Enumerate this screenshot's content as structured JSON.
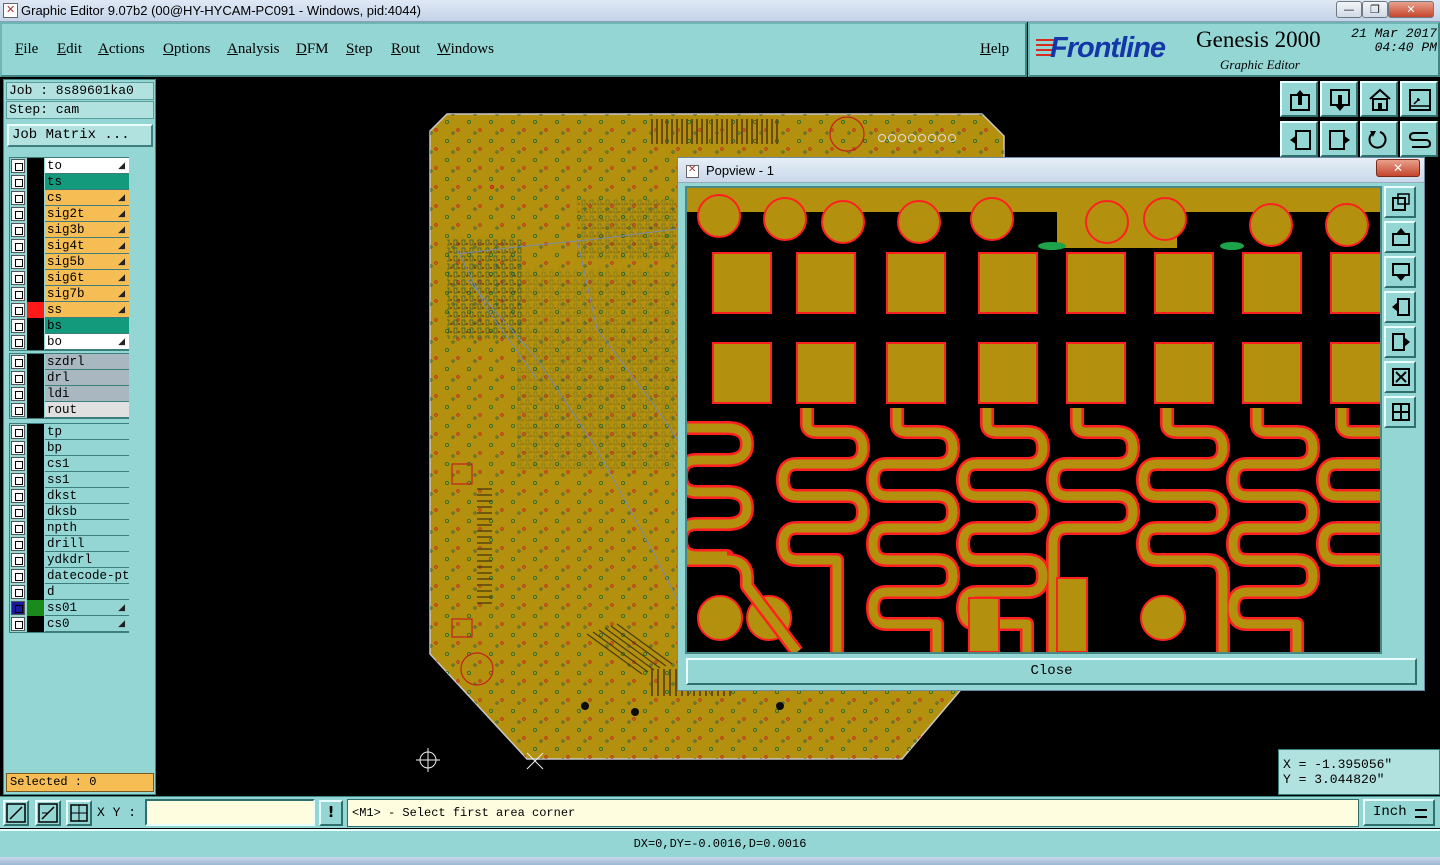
{
  "window": {
    "title": "Graphic Editor 9.07b2 (00@HY-HYCAM-PC091 - Windows, pid:4044)"
  },
  "menu": {
    "items": [
      "File",
      "Edit",
      "Actions",
      "Options",
      "Analysis",
      "DFM",
      "Step",
      "Rout",
      "Windows"
    ],
    "help": "Help"
  },
  "brand": {
    "logo": "Frontline",
    "product": "Genesis 2000",
    "subtitle": "Graphic Editor",
    "date": "21 Mar 2017",
    "time": "04:40 PM"
  },
  "job": {
    "job_label": "Job : 8s89601ka0",
    "step_label": "Step: cam",
    "matrix_button": "Job Matrix ..."
  },
  "layers": {
    "board": [
      {
        "name": "to",
        "color": "#ffffff",
        "lock": true
      },
      {
        "name": "ts",
        "color": "#139a7d",
        "lock": false
      },
      {
        "name": "cs",
        "color": "#f5bd54",
        "lock": true
      },
      {
        "name": "sig2t",
        "color": "#f5bd54",
        "lock": true
      },
      {
        "name": "sig3b",
        "color": "#f5bd54",
        "lock": true
      },
      {
        "name": "sig4t",
        "color": "#f5bd54",
        "lock": true
      },
      {
        "name": "sig5b",
        "color": "#f5bd54",
        "lock": true
      },
      {
        "name": "sig6t",
        "color": "#f5bd54",
        "lock": true
      },
      {
        "name": "sig7b",
        "color": "#f5bd54",
        "lock": true
      },
      {
        "name": "ss",
        "color": "#f5bd54",
        "lock": true,
        "marker": "#ff1a1a"
      },
      {
        "name": "bs",
        "color": "#139a7d",
        "lock": false
      },
      {
        "name": "bo",
        "color": "#ffffff",
        "lock": true
      }
    ],
    "drill": [
      {
        "name": "szdrl",
        "color": "#a9b7c0"
      },
      {
        "name": "drl",
        "color": "#a9b7c0"
      },
      {
        "name": "ldi",
        "color": "#a9b7c0"
      },
      {
        "name": "rout",
        "color": "#e0e0e0"
      }
    ],
    "misc": [
      {
        "name": "tp",
        "color": "#94d6d4"
      },
      {
        "name": "bp",
        "color": "#94d6d4"
      },
      {
        "name": "cs1",
        "color": "#94d6d4"
      },
      {
        "name": "ss1",
        "color": "#94d6d4"
      },
      {
        "name": "dkst",
        "color": "#94d6d4"
      },
      {
        "name": "dksb",
        "color": "#94d6d4"
      },
      {
        "name": "npth",
        "color": "#94d6d4"
      },
      {
        "name": "drill",
        "color": "#94d6d4"
      },
      {
        "name": "ydkdrl",
        "color": "#94d6d4"
      },
      {
        "name": "datecode-ptc",
        "color": "#94d6d4"
      },
      {
        "name": "d",
        "color": "#94d6d4"
      },
      {
        "name": "ss01",
        "color": "#94d6d4",
        "lock": true,
        "marker": "#1a8a1a",
        "checkbox": "#1a1a9a"
      },
      {
        "name": "cs0",
        "color": "#94d6d4",
        "lock": true
      }
    ]
  },
  "selected": "Selected : 0",
  "popview": {
    "title": "Popview - 1",
    "close_x": "✕",
    "close_button": "Close"
  },
  "coords": {
    "x": "X = -1.395056\"",
    "y": "Y = 3.044820\""
  },
  "command": {
    "xy_label": "X Y :",
    "xy_value": "",
    "bang": "!",
    "prompt": "<M1> - Select first area corner",
    "units": "Inch"
  },
  "status": "DX=0,DY=-0.0016,D=0.0016",
  "colors": {
    "panel": "#94d6d4",
    "copper": "#b3910f",
    "outline": "#ff2020",
    "signal_layer": "#f5bd54",
    "solder_mask": "#139a7d"
  }
}
